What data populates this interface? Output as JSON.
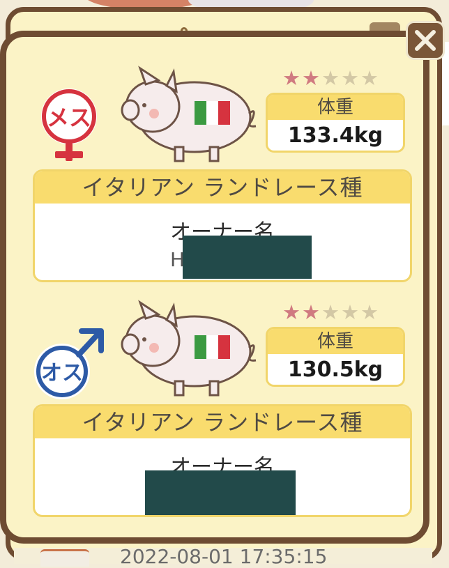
{
  "colors": {
    "frame": "#6e4c32",
    "panel": "#fbf3c6",
    "header_bar": "#f9dc6e",
    "female": "#d6333f",
    "male": "#2d5aa6",
    "star_on": "#d07a80",
    "star_off": "#d3c8a5",
    "redaction": "#224a4a"
  },
  "close_button": {
    "icon": "close-icon"
  },
  "background": {
    "date_text": "2022-08-01 17:35:15"
  },
  "pigs": [
    {
      "sex_label": "メス",
      "sex_icon": "female-symbol-icon",
      "flag": "italy-flag-icon",
      "stars_rating": 2,
      "stars_max": 5,
      "weight_label": "体重",
      "weight_value": "133.4kg",
      "breed": "イタリアン ランドレース種",
      "owner_label": "オーナー名",
      "owner_prefix": "H"
    },
    {
      "sex_label": "オス",
      "sex_icon": "male-symbol-icon",
      "flag": "italy-flag-icon",
      "stars_rating": 2,
      "stars_max": 5,
      "weight_label": "体重",
      "weight_value": "130.5kg",
      "breed": "イタリアン ランドレース種",
      "owner_label": "オーナー名",
      "owner_prefix": ""
    }
  ]
}
